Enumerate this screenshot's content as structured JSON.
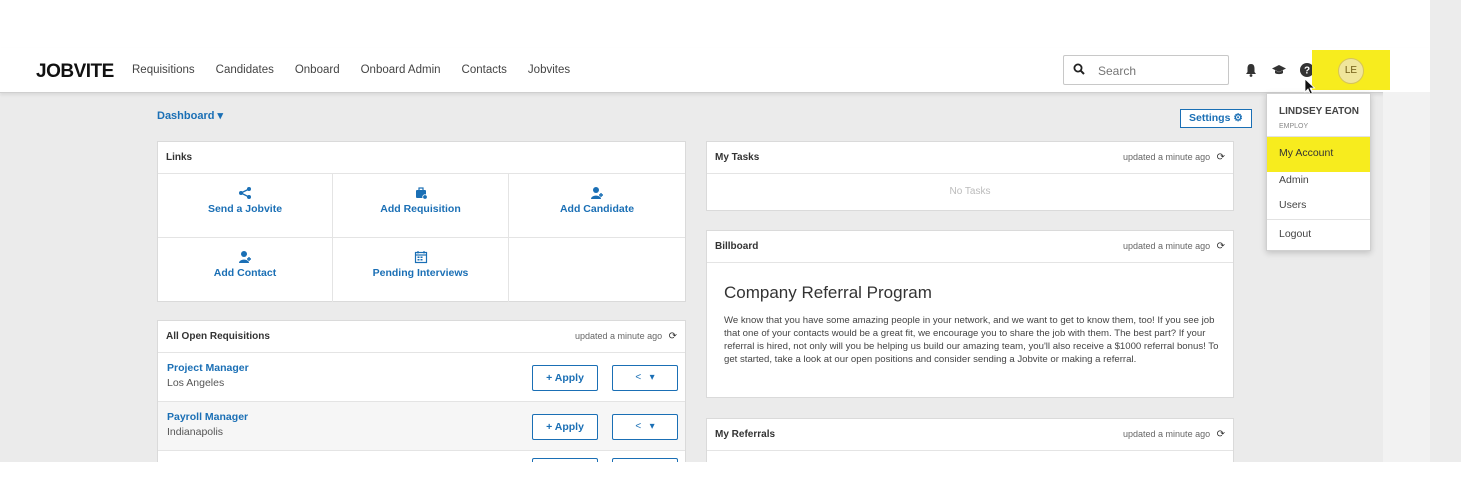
{
  "nav": {
    "logo": "JOBVITE",
    "items": [
      "Requisitions",
      "Candidates",
      "Onboard",
      "Onboard Admin",
      "Contacts",
      "Jobvites"
    ],
    "search_placeholder": "Search",
    "avatar_initials": "LE"
  },
  "dashboard": {
    "dashboard_label": "Dashboard",
    "settings_label": "Settings"
  },
  "links": {
    "title": "Links",
    "items": [
      "Send a Jobvite",
      "Add Requisition",
      "Add Candidate",
      "Add Contact",
      "Pending Interviews"
    ]
  },
  "requisitions": {
    "title": "All Open Requisitions",
    "updated": "updated a minute ago",
    "apply_label": "Apply",
    "rows": [
      {
        "title": "Project Manager",
        "location": "Los Angeles"
      },
      {
        "title": "Payroll Manager",
        "location": "Indianapolis"
      }
    ]
  },
  "tasks": {
    "title": "My Tasks",
    "updated": "updated a minute ago",
    "empty": "No Tasks"
  },
  "billboard": {
    "title": "Billboard",
    "updated": "updated a minute ago",
    "heading": "Company Referral Program",
    "text": "We know that you have some amazing people in your network, and we want to get to know them, too! If you see job that one of your contacts would be a great fit, we encourage you to share the job with them. The best part? If your referral is hired, not only will you be helping us build our amazing team, you'll also receive a $1000 referral bonus! To get started, take a look at our open positions and consider sending a Jobvite or making a referral."
  },
  "referrals": {
    "title": "My Referrals",
    "updated": "updated a minute ago"
  },
  "user_menu": {
    "name": "LINDSEY EATON",
    "role": "EMPLOY",
    "items": [
      "My Account",
      "Admin",
      "Users",
      "Logout"
    ]
  },
  "colors": {
    "accent": "#1a6fb5",
    "highlight": "#f7ec1e"
  }
}
